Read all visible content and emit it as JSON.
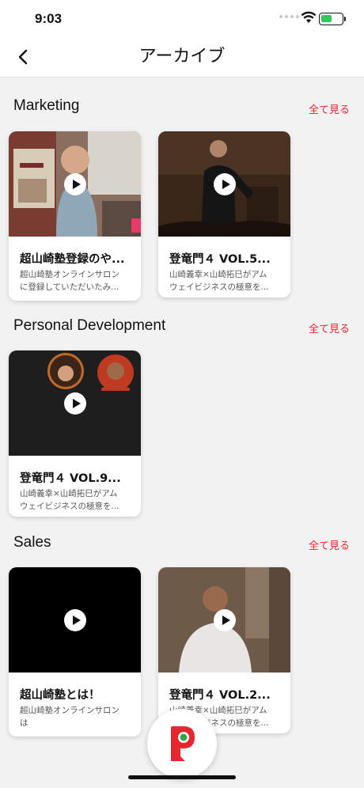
{
  "status": {
    "time": "9:03"
  },
  "nav": {
    "title": "アーカイブ"
  },
  "see_all_label": "全て見る",
  "sections": [
    {
      "title": "Marketing",
      "cards": [
        {
          "title": "超山崎塾登録のや...",
          "desc": [
            "超山崎塾オンラインサロン",
            "に登録していただいたみ..."
          ]
        },
        {
          "title": "登竜門４ VOL.5...",
          "desc": [
            "山崎義幸×山崎拓巳がアム",
            "ウェイビジネスの極意を..."
          ]
        }
      ]
    },
    {
      "title": "Personal Development",
      "cards": [
        {
          "title": "登竜門４ VOL.9...",
          "desc": [
            "山崎義幸×山崎拓巳がアム",
            "ウェイビジネスの極意を..."
          ]
        }
      ]
    },
    {
      "title": "Sales",
      "cards": [
        {
          "title": "超山崎塾とは！",
          "desc": [
            "超山崎塾オンラインサロン",
            "は"
          ]
        },
        {
          "title": "登竜門４ VOL.2...",
          "desc": [
            "山崎義幸×山崎拓巳がアム",
            "ウェイビジネスの極意を..."
          ]
        }
      ]
    }
  ],
  "colors": {
    "accent": "#e8262d",
    "logo_green": "#2eaa4a"
  },
  "icons": {
    "back": "chevron-left-icon",
    "play": "play-icon",
    "fab": "p-logo-icon"
  }
}
